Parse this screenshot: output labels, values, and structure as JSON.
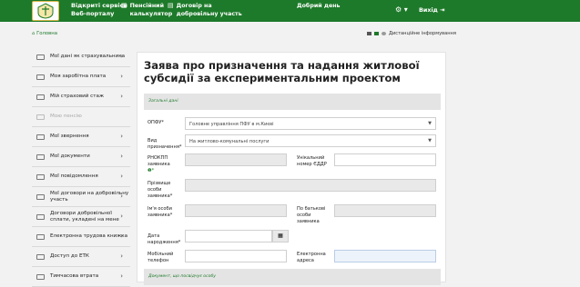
{
  "header": {
    "brand_line1": "Відкриті сервіси",
    "brand_line2": "Веб-порталу",
    "nav": [
      {
        "icon": "calculator-icon",
        "line1": "Пенсійний",
        "line2": "калькулятор"
      },
      {
        "icon": "document-icon",
        "line1": "Договір на",
        "line2": "добровільну участь"
      }
    ],
    "greeting": "Добрий день",
    "exit_label": "Вихід",
    "colors": {
      "header_bg": "#1d7a2a",
      "accent": "#1d7a2a"
    }
  },
  "breadcrumb": {
    "home": "Головна"
  },
  "remote_info": "Дистанційне інформування",
  "sidebar": {
    "items": [
      {
        "label": "Мої дані як страхувальника",
        "icon": "id-card-icon"
      },
      {
        "label": "Моя заробітна плата",
        "icon": "wallet-icon"
      },
      {
        "label": "Мій страховий стаж",
        "icon": "calendar-icon"
      },
      {
        "label": "Мою пенсію",
        "icon": "pension-icon",
        "disabled": true
      },
      {
        "label": "Мої звернення",
        "icon": "message-icon"
      },
      {
        "label": "Мої документи",
        "icon": "file-icon"
      },
      {
        "label": "Мої повідомлення",
        "icon": "mail-icon"
      },
      {
        "label": "Мої договори на добровільну участь",
        "icon": "contract-icon"
      },
      {
        "label": "Договори добровільної сплати, укладені на мене",
        "icon": "handshake-icon"
      },
      {
        "label": "Електронна трудова книжка",
        "icon": "book-icon"
      },
      {
        "label": "Доступ до ЕТК",
        "icon": "key-icon"
      },
      {
        "label": "Тимчасова втрата",
        "icon": "medical-icon"
      }
    ]
  },
  "form": {
    "title": "Заява про призначення та надання житлової субсидії за експериментальним проектом",
    "section_general": "Загальні дані",
    "section_document": "Документ, що посвідчує особу",
    "fields": {
      "opfu_label": "ОПФУ*",
      "opfu_value": "Головне управління ПФУ в м.Києві",
      "type_label": "Вид призначення*",
      "type_value": "На житлово-комунальні послуги",
      "rnokpp_label": "РНОКПП заявника",
      "unzr_label": "Унікальний номер ЄДДР",
      "surname_label": "Прізвище особи заявника*",
      "name_label": "Ім'я особи заявника*",
      "patronymic_label": "По батькові особи заявника",
      "birth_label": "Дата народження*",
      "phone_label": "Мобільний телефон",
      "email_label": "Електронна адреса"
    }
  }
}
